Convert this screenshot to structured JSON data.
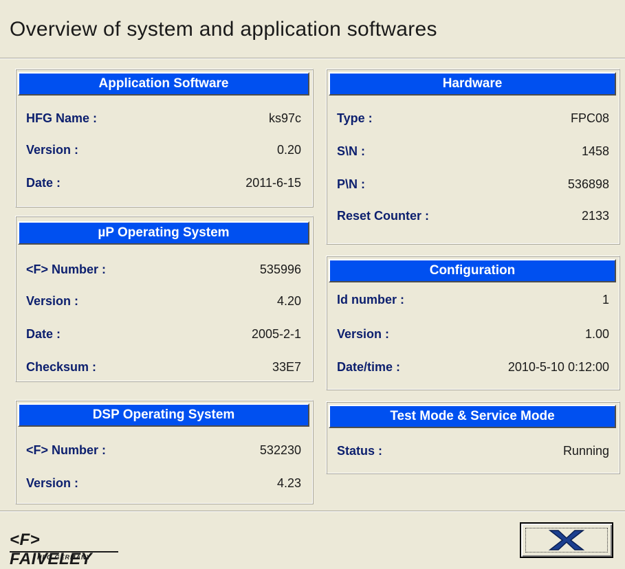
{
  "title": "Overview of system and application softwares",
  "application_software": {
    "header": "Application Software",
    "rows": [
      {
        "label": "HFG Name :",
        "value": "ks97c"
      },
      {
        "label": "Version :",
        "value": "0.20"
      },
      {
        "label": "Date :",
        "value": "2011-6-15"
      }
    ]
  },
  "up_os": {
    "header": "µP Operating System",
    "rows": [
      {
        "label": "<F> Number :",
        "value": "535996"
      },
      {
        "label": "Version :",
        "value": "4.20"
      },
      {
        "label": "Date :",
        "value": "2005-2-1"
      },
      {
        "label": "Checksum :",
        "value": "33E7"
      }
    ]
  },
  "dsp_os": {
    "header": "DSP Operating System",
    "rows": [
      {
        "label": "<F> Number :",
        "value": "532230"
      },
      {
        "label": "Version :",
        "value": "4.23"
      }
    ]
  },
  "hardware": {
    "header": "Hardware",
    "rows": [
      {
        "label": "Type :",
        "value": "FPC08"
      },
      {
        "label": "S\\N :",
        "value": "1458"
      },
      {
        "label": "P\\N :",
        "value": "536898"
      },
      {
        "label": "Reset Counter :",
        "value": "2133"
      }
    ]
  },
  "configuration": {
    "header": "Configuration",
    "rows": [
      {
        "label": "Id number :",
        "value": "1"
      },
      {
        "label": "Version :",
        "value": "1.00"
      },
      {
        "label": "Date/time :",
        "value": "2010-5-10 0:12:00"
      }
    ]
  },
  "test_mode": {
    "header": "Test Mode & Service Mode",
    "rows": [
      {
        "label": "Status :",
        "value": "Running"
      }
    ]
  },
  "logo": {
    "main": "<F> FAIVELEY",
    "sub": "HFG GERMANY"
  },
  "colors": {
    "header_blue": "#0050f0",
    "label_blue": "#0c1f6e",
    "background": "#ece9d8"
  },
  "close_button": {
    "icon": "close-x-icon"
  }
}
